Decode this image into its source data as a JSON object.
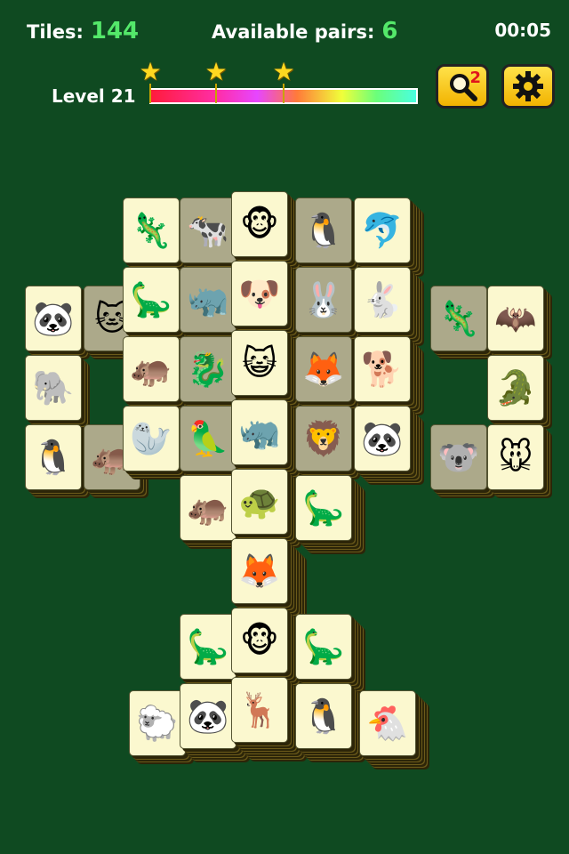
{
  "hud": {
    "tiles_label": "Tiles:",
    "tiles_count": "144",
    "pairs_label": "Available pairs:",
    "pairs_count": "6",
    "timer": "00:05",
    "level_label": "Level 21",
    "hint_count": "2",
    "progress_fraction": 0.0
  },
  "icons": {
    "star": "★",
    "hint": "magnifier-icon",
    "settings": "gear-icon"
  },
  "tiles": [
    {
      "name": "chameleon",
      "glyph": "🦎",
      "blocked": false
    },
    {
      "name": "cow",
      "glyph": "🐄",
      "blocked": true
    },
    {
      "name": "monkey",
      "glyph": "🐵",
      "blocked": false
    },
    {
      "name": "penguin",
      "glyph": "🐧",
      "blocked": true
    },
    {
      "name": "dolphin",
      "glyph": "🐬",
      "blocked": false
    },
    {
      "name": "panda",
      "glyph": "🐼",
      "blocked": false
    },
    {
      "name": "cat",
      "glyph": "🐱",
      "blocked": true
    },
    {
      "name": "dinosaur",
      "glyph": "🦕",
      "blocked": false
    },
    {
      "name": "rhino",
      "glyph": "🦏",
      "blocked": true
    },
    {
      "name": "dog",
      "glyph": "🐶",
      "blocked": false
    },
    {
      "name": "rabbit",
      "glyph": "🐰",
      "blocked": true
    },
    {
      "name": "rabbit",
      "glyph": "🐇",
      "blocked": false
    },
    {
      "name": "chameleon",
      "glyph": "🦎",
      "blocked": true
    },
    {
      "name": "bat",
      "glyph": "🦇",
      "blocked": false
    },
    {
      "name": "elephant",
      "glyph": "🐘",
      "blocked": false
    },
    {
      "name": "hippo",
      "glyph": "🦛",
      "blocked": false
    },
    {
      "name": "seahorse",
      "glyph": "🐉",
      "blocked": true
    },
    {
      "name": "kitten",
      "glyph": "😺",
      "blocked": false
    },
    {
      "name": "fox",
      "glyph": "🦊",
      "blocked": true
    },
    {
      "name": "dog",
      "glyph": "🐕",
      "blocked": false
    },
    {
      "name": "crocodile",
      "glyph": "🐊",
      "blocked": false
    },
    {
      "name": "penguin",
      "glyph": "🐧",
      "blocked": false
    },
    {
      "name": "hippo",
      "glyph": "🦛",
      "blocked": true
    },
    {
      "name": "seal",
      "glyph": "🦭",
      "blocked": false
    },
    {
      "name": "parrot",
      "glyph": "🦜",
      "blocked": true
    },
    {
      "name": "rhino",
      "glyph": "🦏",
      "blocked": false
    },
    {
      "name": "lion",
      "glyph": "🦁",
      "blocked": true
    },
    {
      "name": "panda",
      "glyph": "🐼",
      "blocked": false
    },
    {
      "name": "koala",
      "glyph": "🐨",
      "blocked": true
    },
    {
      "name": "mouse",
      "glyph": "🐭",
      "blocked": false
    },
    {
      "name": "hippo",
      "glyph": "🦛",
      "blocked": false
    },
    {
      "name": "turtle",
      "glyph": "🐢",
      "blocked": false
    },
    {
      "name": "triceratops",
      "glyph": "🦕",
      "blocked": false
    },
    {
      "name": "fox",
      "glyph": "🦊",
      "blocked": false
    },
    {
      "name": "triceratops",
      "glyph": "🦕",
      "blocked": false
    },
    {
      "name": "monkey",
      "glyph": "🐵",
      "blocked": false
    },
    {
      "name": "triceratops",
      "glyph": "🦕",
      "blocked": false
    },
    {
      "name": "sheep",
      "glyph": "🐑",
      "blocked": false
    },
    {
      "name": "panda",
      "glyph": "🐼",
      "blocked": false
    },
    {
      "name": "reindeer",
      "glyph": "🦌",
      "blocked": false
    },
    {
      "name": "penguin",
      "glyph": "🐧",
      "blocked": false
    },
    {
      "name": "chicken",
      "glyph": "🐔",
      "blocked": false
    }
  ]
}
